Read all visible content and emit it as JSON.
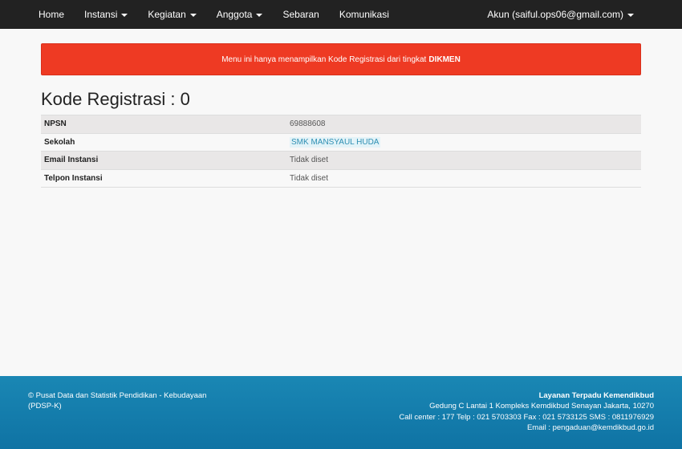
{
  "nav": {
    "items": [
      {
        "label": "Home",
        "dropdown": false
      },
      {
        "label": "Instansi",
        "dropdown": true
      },
      {
        "label": "Kegiatan",
        "dropdown": true
      },
      {
        "label": "Anggota",
        "dropdown": true
      },
      {
        "label": "Sebaran",
        "dropdown": false
      },
      {
        "label": "Komunikasi",
        "dropdown": false
      }
    ],
    "account_label": "Akun (saiful.ops06@gmail.com)"
  },
  "alert": {
    "text": "Menu ini hanya menampilkan Kode Registrasi dari tingkat",
    "emphasis": "DIKMEN",
    "color": "#ee3a23"
  },
  "page_title": "Kode Registrasi : 0",
  "table": {
    "rows": [
      {
        "key": "NPSN",
        "value": "69888608"
      },
      {
        "key": "Sekolah",
        "value": "SMK MANSYAUL HUDA"
      },
      {
        "key": "Email Instansi",
        "value": "Tidak diset"
      },
      {
        "key": "Telpon Instansi",
        "value": "Tidak diset"
      }
    ]
  },
  "footer": {
    "left_line1": "© Pusat Data dan Statistik Pendidikan - Kebudayaan",
    "left_line2": "(PDSP-K)",
    "right_title": "Layanan Terpadu Kemendikbud",
    "right_line1": "Gedung C Lantai 1 Kompleks Kemdikbud Senayan Jakarta, 10270",
    "right_line2": "Call center : 177 Telp : 021 5703303 Fax : 021 5733125 SMS : 0811976929",
    "right_line3": "Email : pengaduan@kemdikbud.go.id",
    "color": "#1a87b4"
  }
}
